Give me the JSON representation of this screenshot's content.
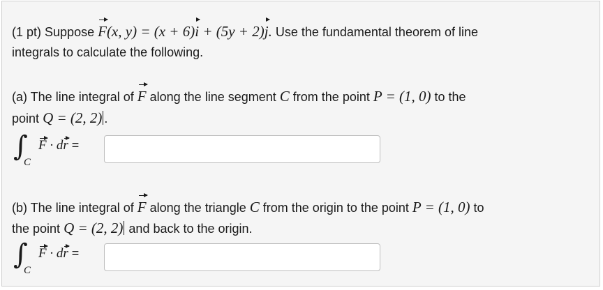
{
  "problem": {
    "points": "(1 pt)",
    "intro_text_1": "Suppose",
    "field_name": "F",
    "field_args": "(x, y) = (x + 6)",
    "i_hat": "i",
    "field_mid": " + (5y + 2)",
    "j_hat": "j",
    "field_end": ".",
    "intro_text_2": "Use the fundamental theorem of line",
    "intro_text_3": "integrals to calculate the following."
  },
  "part_a": {
    "label": "(a) The line integral of",
    "field": "F",
    "text_1": "along the line segment",
    "curve": "C",
    "text_2": "from the point",
    "point_p": "P = (1, 0)",
    "text_3": "to the",
    "text_4": "point",
    "point_q": "Q = (2, 2)",
    "end": ".",
    "integral_sub": "C",
    "integral_F": "F",
    "integral_dot": " · d",
    "integral_r": "r",
    "equals": " =",
    "answer_value": ""
  },
  "part_b": {
    "label": "(b) The line integral of",
    "field": "F",
    "text_1": "along the triangle",
    "curve": "C",
    "text_2": "from the origin to the point",
    "point_p": "P = (1, 0)",
    "text_3": "to",
    "text_4": "the point",
    "point_q": "Q = (2, 2)",
    "text_5": "and back to the origin.",
    "integral_sub": "C",
    "integral_F": "F",
    "integral_dot": " · d",
    "integral_r": "r",
    "equals": " =",
    "answer_value": ""
  }
}
